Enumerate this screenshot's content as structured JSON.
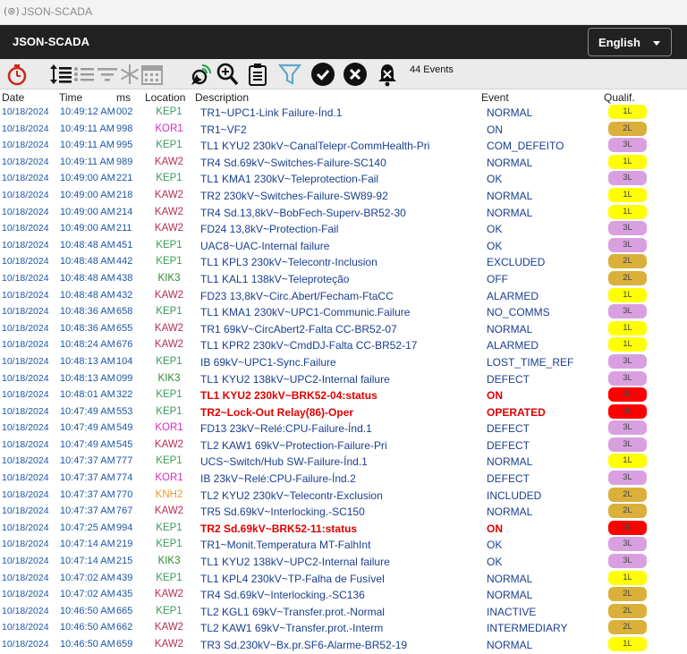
{
  "window": {
    "title": "JSON-SCADA",
    "icon": "app-icon"
  },
  "header": {
    "brand": "JSON-SCADA",
    "language": "English"
  },
  "toolbar": {
    "events_count": "44 Events",
    "icons": [
      "timer-icon",
      "sort-icon",
      "list-icon",
      "filter-lines-icon",
      "snowflake-icon",
      "calendar-icon",
      "satellite-icon",
      "zoom-icon",
      "clipboard-icon",
      "filter-icon",
      "check-circle-icon",
      "x-circle-icon",
      "bell-mute-icon"
    ]
  },
  "columns": {
    "date": "Date",
    "time": "Time",
    "ms": "ms",
    "location": "Location",
    "description": "Description",
    "event": "Event",
    "qualifier": "Qualif."
  },
  "colors": {
    "loc_KEP1": "#3a9a5a",
    "loc_KOR1": "#d02ec0",
    "loc_KAW2": "#b03050",
    "loc_KIK3": "#2e8a2e",
    "loc_KNH2": "#e89a30",
    "q_1L": "#ffff00",
    "q_2L": "#dab03a",
    "q_3L": "#d9a0e0",
    "q_0L": "#ff0000"
  },
  "events": [
    {
      "date": "10/18/2024",
      "time": "10:49:12 AM",
      "ms": "002",
      "location": "KEP1",
      "description": "TR1~UPC1-Link Failure-Índ.1",
      "event": "NORMAL",
      "qualifier": "1L",
      "alarm": false
    },
    {
      "date": "10/18/2024",
      "time": "10:49:11 AM",
      "ms": "998",
      "location": "KOR1",
      "description": "TR1~VF2",
      "event": "ON",
      "qualifier": "2L",
      "alarm": false
    },
    {
      "date": "10/18/2024",
      "time": "10:49:11 AM",
      "ms": "995",
      "location": "KEP1",
      "description": "TL1 KYU2 230kV~CanalTelepr-CommHealth-Pri",
      "event": "COM_DEFEITO",
      "qualifier": "3L",
      "alarm": false
    },
    {
      "date": "10/18/2024",
      "time": "10:49:11 AM",
      "ms": "989",
      "location": "KAW2",
      "description": "TR4 Sd.69kV~Switches-Failure-SC140",
      "event": "NORMAL",
      "qualifier": "1L",
      "alarm": false
    },
    {
      "date": "10/18/2024",
      "time": "10:49:00 AM",
      "ms": "221",
      "location": "KEP1",
      "description": "TL1 KMA1 230kV~Teleprotection-Fail",
      "event": "OK",
      "qualifier": "3L",
      "alarm": false
    },
    {
      "date": "10/18/2024",
      "time": "10:49:00 AM",
      "ms": "218",
      "location": "KAW2",
      "description": "TR2 230kV~Switches-Failure-SW89-92",
      "event": "NORMAL",
      "qualifier": "1L",
      "alarm": false
    },
    {
      "date": "10/18/2024",
      "time": "10:49:00 AM",
      "ms": "214",
      "location": "KAW2",
      "description": "TR4 Sd.13,8kV~BobFech-Superv-BR52-30",
      "event": "NORMAL",
      "qualifier": "1L",
      "alarm": false
    },
    {
      "date": "10/18/2024",
      "time": "10:49:00 AM",
      "ms": "211",
      "location": "KAW2",
      "description": "FD24 13,8kV~Protection-Fail",
      "event": "OK",
      "qualifier": "3L",
      "alarm": false
    },
    {
      "date": "10/18/2024",
      "time": "10:48:48 AM",
      "ms": "451",
      "location": "KEP1",
      "description": "UAC8~UAC-Internal failure",
      "event": "OK",
      "qualifier": "3L",
      "alarm": false
    },
    {
      "date": "10/18/2024",
      "time": "10:48:48 AM",
      "ms": "442",
      "location": "KEP1",
      "description": "TL1 KPL3 230kV~Telecontr-Inclusion",
      "event": "EXCLUDED",
      "qualifier": "2L",
      "alarm": false
    },
    {
      "date": "10/18/2024",
      "time": "10:48:48 AM",
      "ms": "438",
      "location": "KIK3",
      "description": "TL1 KAL1 138kV~Teleproteção",
      "event": "OFF",
      "qualifier": "2L",
      "alarm": false
    },
    {
      "date": "10/18/2024",
      "time": "10:48:48 AM",
      "ms": "432",
      "location": "KAW2",
      "description": "FD23 13,8kV~Circ.Abert/Fecham-FtaCC",
      "event": "ALARMED",
      "qualifier": "1L",
      "alarm": false
    },
    {
      "date": "10/18/2024",
      "time": "10:48:36 AM",
      "ms": "658",
      "location": "KEP1",
      "description": "TL1 KMA1 230kV~UPC1-Communic.Failure",
      "event": "NO_COMMS",
      "qualifier": "3L",
      "alarm": false
    },
    {
      "date": "10/18/2024",
      "time": "10:48:36 AM",
      "ms": "655",
      "location": "KAW2",
      "description": "TR1 69kV~CircAbert2-Falta CC-BR52-07",
      "event": "NORMAL",
      "qualifier": "1L",
      "alarm": false
    },
    {
      "date": "10/18/2024",
      "time": "10:48:24 AM",
      "ms": "676",
      "location": "KAW2",
      "description": "TL1 KPR2 230kV~CmdDJ-Falta CC-BR52-17",
      "event": "ALARMED",
      "qualifier": "1L",
      "alarm": false
    },
    {
      "date": "10/18/2024",
      "time": "10:48:13 AM",
      "ms": "104",
      "location": "KEP1",
      "description": "IB 69kV~UPC1-Sync.Failure",
      "event": "LOST_TIME_REF",
      "qualifier": "3L",
      "alarm": false
    },
    {
      "date": "10/18/2024",
      "time": "10:48:13 AM",
      "ms": "099",
      "location": "KIK3",
      "description": "TL1 KYU2 138kV~UPC2-Internal failure",
      "event": "DEFECT",
      "qualifier": "3L",
      "alarm": false
    },
    {
      "date": "10/18/2024",
      "time": "10:48:01 AM",
      "ms": "322",
      "location": "KEP1",
      "description": "TL1 KYU2 230kV~BRK52-04:status",
      "event": "ON",
      "qualifier": "0L",
      "alarm": true
    },
    {
      "date": "10/18/2024",
      "time": "10:47:49 AM",
      "ms": "553",
      "location": "KEP1",
      "description": "TR2~Lock-Out Relay(86)-Oper",
      "event": "OPERATED",
      "qualifier": "0L",
      "alarm": true
    },
    {
      "date": "10/18/2024",
      "time": "10:47:49 AM",
      "ms": "549",
      "location": "KOR1",
      "description": "FD13 23kV~Relé:CPU-Failure-Índ.1",
      "event": "DEFECT",
      "qualifier": "3L",
      "alarm": false
    },
    {
      "date": "10/18/2024",
      "time": "10:47:49 AM",
      "ms": "545",
      "location": "KAW2",
      "description": "TL2 KAW1 69kV~Protection-Failure-Pri",
      "event": "DEFECT",
      "qualifier": "3L",
      "alarm": false
    },
    {
      "date": "10/18/2024",
      "time": "10:47:37 AM",
      "ms": "777",
      "location": "KEP1",
      "description": "UCS~Switch/Hub SW-Failure-Índ.1",
      "event": "NORMAL",
      "qualifier": "1L",
      "alarm": false
    },
    {
      "date": "10/18/2024",
      "time": "10:47:37 AM",
      "ms": "774",
      "location": "KOR1",
      "description": "IB 23kV~Relé:CPU-Failure-Índ.2",
      "event": "DEFECT",
      "qualifier": "3L",
      "alarm": false
    },
    {
      "date": "10/18/2024",
      "time": "10:47:37 AM",
      "ms": "770",
      "location": "KNH2",
      "description": "TL2 KYU2 230kV~Telecontr-Exclusion",
      "event": "INCLUDED",
      "qualifier": "2L",
      "alarm": false
    },
    {
      "date": "10/18/2024",
      "time": "10:47:37 AM",
      "ms": "767",
      "location": "KAW2",
      "description": "TR5 Sd.69kV~Interlocking.-SC150",
      "event": "NORMAL",
      "qualifier": "2L",
      "alarm": false
    },
    {
      "date": "10/18/2024",
      "time": "10:47:25 AM",
      "ms": "994",
      "location": "KEP1",
      "description": "TR2 Sd.69kV~BRK52-11:status",
      "event": "ON",
      "qualifier": "0L",
      "alarm": true
    },
    {
      "date": "10/18/2024",
      "time": "10:47:14 AM",
      "ms": "219",
      "location": "KEP1",
      "description": "TR1~Monit.Temperatura MT-FalhInt",
      "event": "OK",
      "qualifier": "3L",
      "alarm": false
    },
    {
      "date": "10/18/2024",
      "time": "10:47:14 AM",
      "ms": "215",
      "location": "KIK3",
      "description": "TL1 KYU2 138kV~UPC2-Internal failure",
      "event": "OK",
      "qualifier": "3L",
      "alarm": false
    },
    {
      "date": "10/18/2024",
      "time": "10:47:02 AM",
      "ms": "439",
      "location": "KEP1",
      "description": "TL1 KPL4 230kV~TP-Falha de Fusível",
      "event": "NORMAL",
      "qualifier": "1L",
      "alarm": false
    },
    {
      "date": "10/18/2024",
      "time": "10:47:02 AM",
      "ms": "435",
      "location": "KAW2",
      "description": "TR4 Sd.69kV~Interlocking.-SC136",
      "event": "NORMAL",
      "qualifier": "2L",
      "alarm": false
    },
    {
      "date": "10/18/2024",
      "time": "10:46:50 AM",
      "ms": "665",
      "location": "KEP1",
      "description": "TL2 KGL1 69kV~Transfer.prot.-Normal",
      "event": "INACTIVE",
      "qualifier": "2L",
      "alarm": false
    },
    {
      "date": "10/18/2024",
      "time": "10:46:50 AM",
      "ms": "662",
      "location": "KAW2",
      "description": "TL2 KAW1 69kV~Transfer.prot.-Interm",
      "event": "INTERMEDIARY",
      "qualifier": "2L",
      "alarm": false
    },
    {
      "date": "10/18/2024",
      "time": "10:46:50 AM",
      "ms": "659",
      "location": "KAW2",
      "description": "TR3 Sd.230kV~Bx.pr.SF6-Alarme-BR52-19",
      "event": "NORMAL",
      "qualifier": "1L",
      "alarm": false
    }
  ]
}
